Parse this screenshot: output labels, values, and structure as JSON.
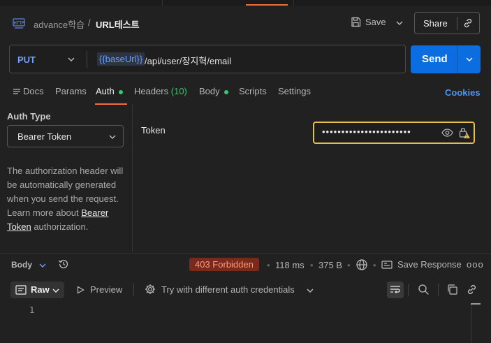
{
  "header": {
    "collection": "advance학습",
    "separator": "/",
    "request_title": "URL테스트",
    "save_label": "Save",
    "share_label": "Share"
  },
  "request": {
    "method": "PUT",
    "url_variable": "{{baseUrl}}",
    "url_path": "/api/user/장지혁/email",
    "send_label": "Send"
  },
  "tabs": {
    "docs": "Docs",
    "params": "Params",
    "auth": "Auth",
    "headers": "Headers",
    "headers_count": "(10)",
    "body": "Body",
    "scripts": "Scripts",
    "settings": "Settings",
    "cookies": "Cookies"
  },
  "auth": {
    "type_label": "Auth Type",
    "type_value": "Bearer Token",
    "help_text": "The authorization header will be automatically generated when you send the request. Learn more about ",
    "help_link": "Bearer Token",
    "help_suffix": " authorization.",
    "token_label": "Token",
    "token_value": "•••••••••••••••••••••••"
  },
  "response": {
    "body_label": "Body",
    "status": "403 Forbidden",
    "time": "118 ms",
    "size": "375 B",
    "separator_dot": "•",
    "save_response": "Save Response",
    "more": "ooo",
    "raw_label": "Raw",
    "preview_label": "Preview",
    "try_auth_label": "Try with different auth credentials",
    "line_numbers": [
      "1"
    ]
  },
  "colors": {
    "accent": "#f26b3a",
    "send": "#0b6de0",
    "status_error": "#ff9a7a",
    "token_border": "#e8bf4a",
    "active_dot": "#2ecc71"
  }
}
